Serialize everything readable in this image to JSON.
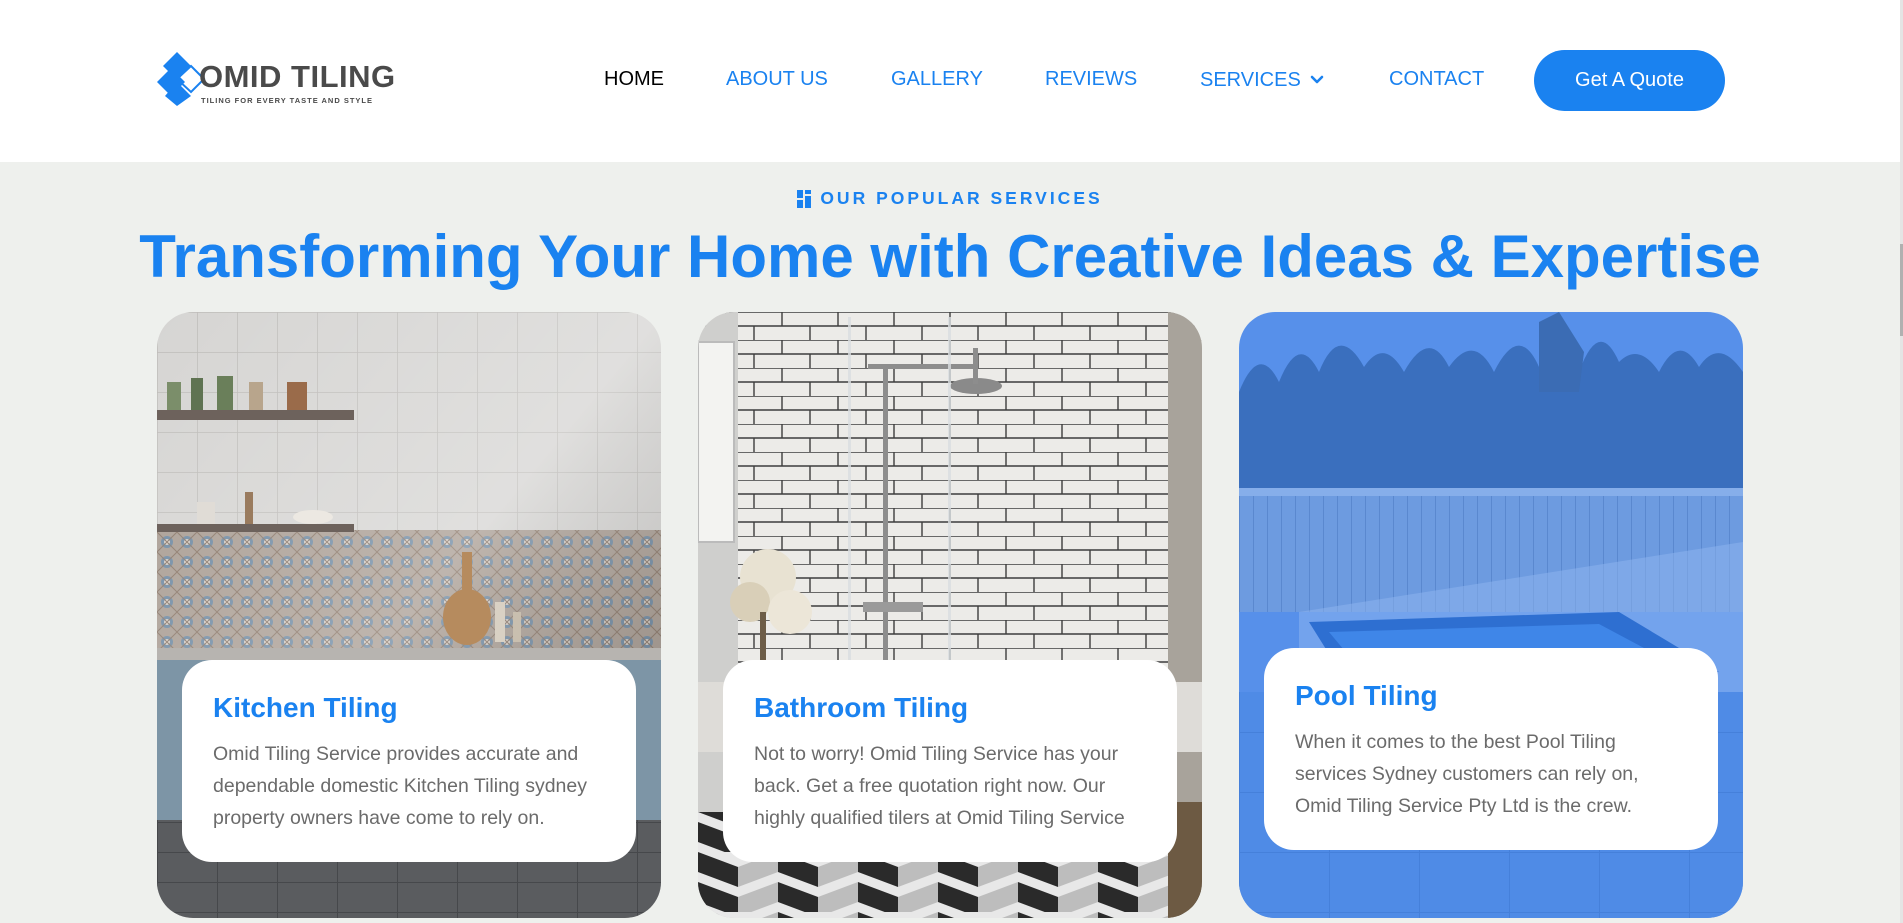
{
  "brand": {
    "name": "OMID TILING",
    "tagline": "TILING FOR EVERY TASTE AND STYLE",
    "color": "#1a82f0"
  },
  "nav": {
    "items": [
      {
        "label": "HOME",
        "active": true
      },
      {
        "label": "ABOUT US",
        "active": false
      },
      {
        "label": "GALLERY",
        "active": false
      },
      {
        "label": "REVIEWS",
        "active": false
      },
      {
        "label": "SERVICES",
        "active": false,
        "icon": "chevron-down-icon"
      },
      {
        "label": "CONTACT",
        "active": false
      }
    ],
    "cta_label": "Get A Quote"
  },
  "section": {
    "eyebrow": "OUR POPULAR SERVICES",
    "eyebrow_icon": "tile-grid-icon",
    "title": "Transforming Your Home with Creative Ideas & Expertise"
  },
  "cards": [
    {
      "title": "Kitchen Tiling",
      "description": "Omid Tiling Service provides accurate and dependable domestic Kitchen Tiling sydney property owners have come to rely on."
    },
    {
      "title": "Bathroom Tiling",
      "description": "Not to worry! Omid Tiling Service has your back. Get a free quotation right now. Our highly qualified tilers at Omid Tiling Service"
    },
    {
      "title": "Pool Tiling",
      "description": "When it comes to the best Pool Tiling services Sydney customers can rely on, Omid Tiling Service Pty Ltd is the crew."
    }
  ]
}
